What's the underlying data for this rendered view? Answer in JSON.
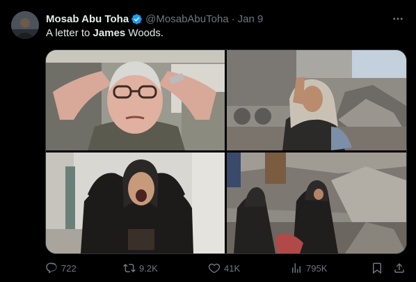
{
  "author": {
    "name": "Mosab Abu Toha",
    "handle": "@MosabAbuToha",
    "separator": "·",
    "date": "Jan 9"
  },
  "text": {
    "prefix": "A letter to ",
    "bold": "James",
    "suffix": " Woods."
  },
  "stats": {
    "replies": "722",
    "retweets": "9.2K",
    "likes": "41K",
    "views": "795K"
  },
  "colors": {
    "background": "#000000",
    "text": "#e7e9ea",
    "muted": "#71767b",
    "verified": "#1d9bf0"
  }
}
